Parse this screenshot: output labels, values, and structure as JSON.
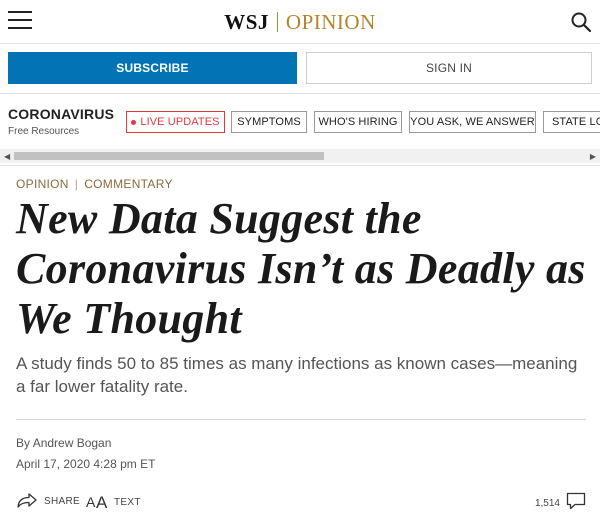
{
  "header": {
    "brand": "WSJ",
    "section": "OPINION"
  },
  "auth": {
    "subscribe_label": "SUBSCRIBE",
    "signin_label": "SIGN IN"
  },
  "coronavirus_nav": {
    "title": "CORONAVIRUS",
    "subtitle": "Free Resources",
    "items": [
      {
        "label": "LIVE UPDATES",
        "live": true
      },
      {
        "label": "SYMPTOMS"
      },
      {
        "label": "WHO'S HIRING"
      },
      {
        "label": "YOU ASK, WE ANSWER"
      },
      {
        "label": "STATE LOCKDOWNS"
      }
    ]
  },
  "article": {
    "kicker": [
      "OPINION",
      "COMMENTARY"
    ],
    "headline": "New Data Suggest the Coronavirus Isn’t as Deadly as We Thought",
    "dek": "A study finds 50 to 85 times as many infections as known cases—meaning a far lower fatality rate.",
    "byline_prefix": "By",
    "author": "Andrew Bogan",
    "timestamp": "April 17, 2020 4:28 pm ET"
  },
  "tools": {
    "share_label": "SHARE",
    "text_label": "TEXT",
    "comment_count": "1,514"
  },
  "icons": {
    "menu": "hamburger-menu-icon",
    "search": "search-icon",
    "share": "share-arrow-icon",
    "text": "text-size-icon",
    "comments": "comment-bubble-icon"
  },
  "colors": {
    "subscribe": "#0274b6",
    "opinion_gold": "#b5852a",
    "live_red": "#e0393e"
  }
}
